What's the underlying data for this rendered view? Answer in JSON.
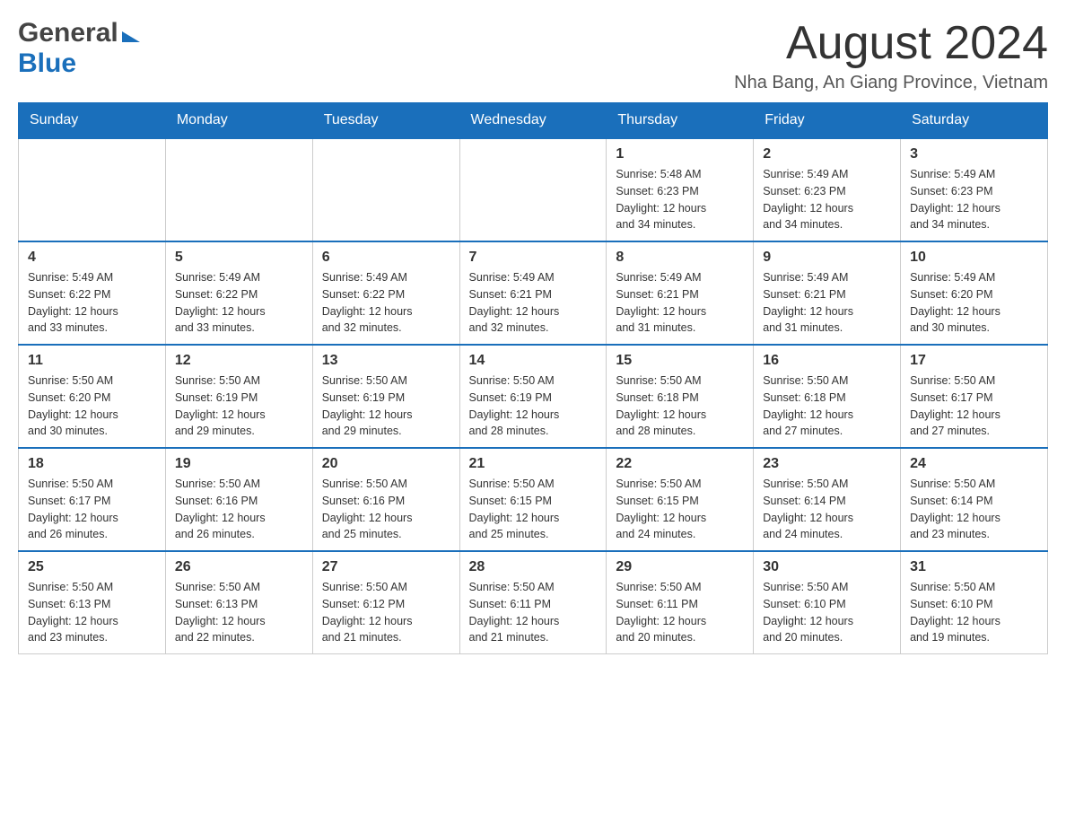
{
  "header": {
    "logo": {
      "general": "General",
      "blue": "Blue",
      "arrow": "▶"
    },
    "title": "August 2024",
    "location": "Nha Bang, An Giang Province, Vietnam"
  },
  "calendar": {
    "days_of_week": [
      "Sunday",
      "Monday",
      "Tuesday",
      "Wednesday",
      "Thursday",
      "Friday",
      "Saturday"
    ],
    "weeks": [
      {
        "days": [
          {
            "number": "",
            "info": ""
          },
          {
            "number": "",
            "info": ""
          },
          {
            "number": "",
            "info": ""
          },
          {
            "number": "",
            "info": ""
          },
          {
            "number": "1",
            "info": "Sunrise: 5:48 AM\nSunset: 6:23 PM\nDaylight: 12 hours\nand 34 minutes."
          },
          {
            "number": "2",
            "info": "Sunrise: 5:49 AM\nSunset: 6:23 PM\nDaylight: 12 hours\nand 34 minutes."
          },
          {
            "number": "3",
            "info": "Sunrise: 5:49 AM\nSunset: 6:23 PM\nDaylight: 12 hours\nand 34 minutes."
          }
        ]
      },
      {
        "days": [
          {
            "number": "4",
            "info": "Sunrise: 5:49 AM\nSunset: 6:22 PM\nDaylight: 12 hours\nand 33 minutes."
          },
          {
            "number": "5",
            "info": "Sunrise: 5:49 AM\nSunset: 6:22 PM\nDaylight: 12 hours\nand 33 minutes."
          },
          {
            "number": "6",
            "info": "Sunrise: 5:49 AM\nSunset: 6:22 PM\nDaylight: 12 hours\nand 32 minutes."
          },
          {
            "number": "7",
            "info": "Sunrise: 5:49 AM\nSunset: 6:21 PM\nDaylight: 12 hours\nand 32 minutes."
          },
          {
            "number": "8",
            "info": "Sunrise: 5:49 AM\nSunset: 6:21 PM\nDaylight: 12 hours\nand 31 minutes."
          },
          {
            "number": "9",
            "info": "Sunrise: 5:49 AM\nSunset: 6:21 PM\nDaylight: 12 hours\nand 31 minutes."
          },
          {
            "number": "10",
            "info": "Sunrise: 5:49 AM\nSunset: 6:20 PM\nDaylight: 12 hours\nand 30 minutes."
          }
        ]
      },
      {
        "days": [
          {
            "number": "11",
            "info": "Sunrise: 5:50 AM\nSunset: 6:20 PM\nDaylight: 12 hours\nand 30 minutes."
          },
          {
            "number": "12",
            "info": "Sunrise: 5:50 AM\nSunset: 6:19 PM\nDaylight: 12 hours\nand 29 minutes."
          },
          {
            "number": "13",
            "info": "Sunrise: 5:50 AM\nSunset: 6:19 PM\nDaylight: 12 hours\nand 29 minutes."
          },
          {
            "number": "14",
            "info": "Sunrise: 5:50 AM\nSunset: 6:19 PM\nDaylight: 12 hours\nand 28 minutes."
          },
          {
            "number": "15",
            "info": "Sunrise: 5:50 AM\nSunset: 6:18 PM\nDaylight: 12 hours\nand 28 minutes."
          },
          {
            "number": "16",
            "info": "Sunrise: 5:50 AM\nSunset: 6:18 PM\nDaylight: 12 hours\nand 27 minutes."
          },
          {
            "number": "17",
            "info": "Sunrise: 5:50 AM\nSunset: 6:17 PM\nDaylight: 12 hours\nand 27 minutes."
          }
        ]
      },
      {
        "days": [
          {
            "number": "18",
            "info": "Sunrise: 5:50 AM\nSunset: 6:17 PM\nDaylight: 12 hours\nand 26 minutes."
          },
          {
            "number": "19",
            "info": "Sunrise: 5:50 AM\nSunset: 6:16 PM\nDaylight: 12 hours\nand 26 minutes."
          },
          {
            "number": "20",
            "info": "Sunrise: 5:50 AM\nSunset: 6:16 PM\nDaylight: 12 hours\nand 25 minutes."
          },
          {
            "number": "21",
            "info": "Sunrise: 5:50 AM\nSunset: 6:15 PM\nDaylight: 12 hours\nand 25 minutes."
          },
          {
            "number": "22",
            "info": "Sunrise: 5:50 AM\nSunset: 6:15 PM\nDaylight: 12 hours\nand 24 minutes."
          },
          {
            "number": "23",
            "info": "Sunrise: 5:50 AM\nSunset: 6:14 PM\nDaylight: 12 hours\nand 24 minutes."
          },
          {
            "number": "24",
            "info": "Sunrise: 5:50 AM\nSunset: 6:14 PM\nDaylight: 12 hours\nand 23 minutes."
          }
        ]
      },
      {
        "days": [
          {
            "number": "25",
            "info": "Sunrise: 5:50 AM\nSunset: 6:13 PM\nDaylight: 12 hours\nand 23 minutes."
          },
          {
            "number": "26",
            "info": "Sunrise: 5:50 AM\nSunset: 6:13 PM\nDaylight: 12 hours\nand 22 minutes."
          },
          {
            "number": "27",
            "info": "Sunrise: 5:50 AM\nSunset: 6:12 PM\nDaylight: 12 hours\nand 21 minutes."
          },
          {
            "number": "28",
            "info": "Sunrise: 5:50 AM\nSunset: 6:11 PM\nDaylight: 12 hours\nand 21 minutes."
          },
          {
            "number": "29",
            "info": "Sunrise: 5:50 AM\nSunset: 6:11 PM\nDaylight: 12 hours\nand 20 minutes."
          },
          {
            "number": "30",
            "info": "Sunrise: 5:50 AM\nSunset: 6:10 PM\nDaylight: 12 hours\nand 20 minutes."
          },
          {
            "number": "31",
            "info": "Sunrise: 5:50 AM\nSunset: 6:10 PM\nDaylight: 12 hours\nand 19 minutes."
          }
        ]
      }
    ]
  }
}
